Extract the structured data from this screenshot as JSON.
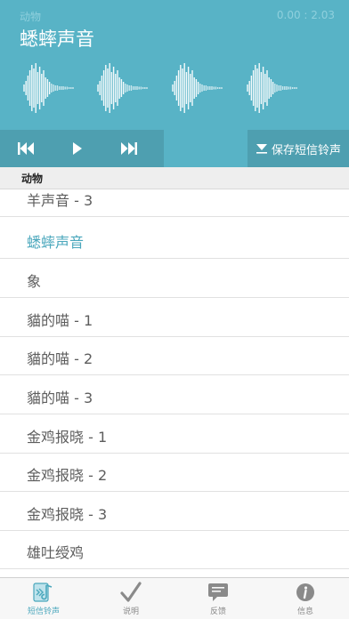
{
  "header": {
    "category": "动物",
    "time": "0.00 : 2.03",
    "title": "蟋蟀声音"
  },
  "controls": {
    "prev_icon": "skip-back-icon",
    "play_icon": "play-icon",
    "next_icon": "skip-forward-icon",
    "save_label": "保存短信铃声",
    "save_icon": "download-icon"
  },
  "section_title": "动物",
  "list_items": [
    "羊声音 - 3",
    "蟋蟀声音",
    "象",
    "貓的喵 - 1",
    "貓的喵 - 2",
    "貓的喵 - 3",
    "金鸡报晓 - 1",
    "金鸡报晓 - 2",
    "金鸡报晓 - 3",
    "雄吐绶鸡"
  ],
  "selected_item": "蟋蟀声音",
  "tabs": [
    {
      "label": "短信铃声",
      "icon": "ringtone-icon",
      "active": true
    },
    {
      "label": "说明",
      "icon": "checkmark-icon",
      "active": false
    },
    {
      "label": "反馈",
      "icon": "chat-bubble-icon",
      "active": false
    },
    {
      "label": "信息",
      "icon": "info-icon",
      "active": false
    }
  ],
  "colors": {
    "header_bg": "#58b3c6",
    "button_bg": "#4e9fb0",
    "accent": "#4aa7bc"
  }
}
